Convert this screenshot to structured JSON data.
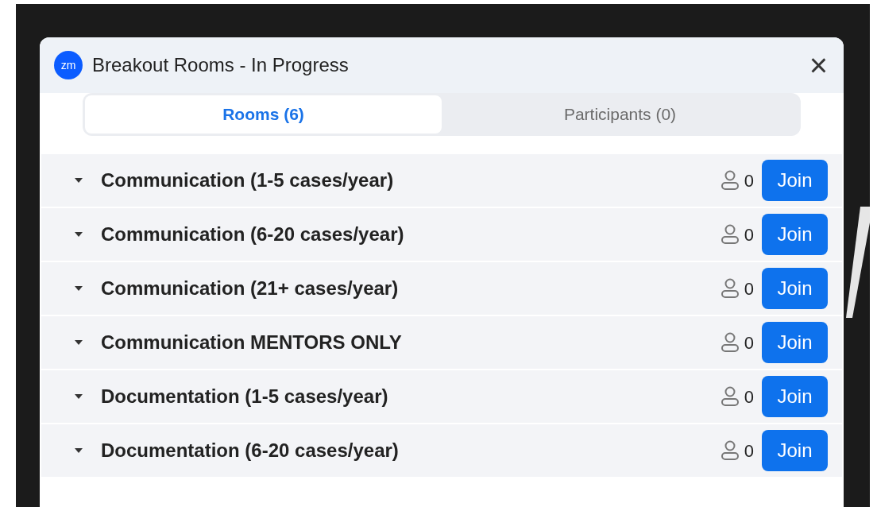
{
  "window": {
    "title": "Breakout Rooms - In Progress",
    "logo": "zm",
    "close": "×"
  },
  "tabs": [
    {
      "label": "Rooms (6)",
      "selected": true
    },
    {
      "label": "Participants (0)",
      "selected": false
    }
  ],
  "rooms": [
    {
      "name": "Communication (1-5 cases/year)",
      "count": "0",
      "button": "Join"
    },
    {
      "name": "Communication (6-20 cases/year)",
      "count": "0",
      "button": "Join"
    },
    {
      "name": "Communication (21+ cases/year)",
      "count": "0",
      "button": "Join"
    },
    {
      "name": "Communication MENTORS ONLY",
      "count": "0",
      "button": "Join"
    },
    {
      "name": "Documentation (1-5 cases/year)",
      "count": "0",
      "button": "Join"
    },
    {
      "name": "Documentation (6-20 cases/year)",
      "count": "0",
      "button": "Join"
    }
  ]
}
